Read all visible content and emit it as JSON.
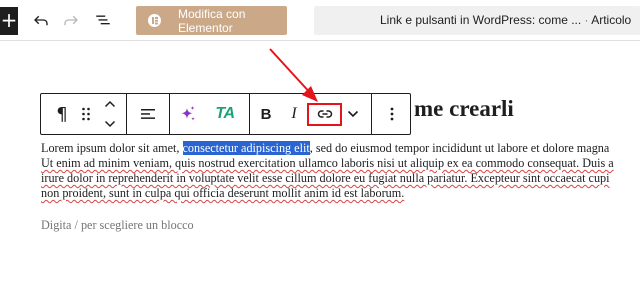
{
  "topbar": {
    "inserter_symbol": "+",
    "elementor_label": "Modifica con Elementor",
    "doc_title": "Link e pulsanti in WordPress: come ...",
    "doc_separator": "·",
    "doc_type": "Articolo",
    "icons": [
      "plus-icon",
      "undo-icon",
      "redo-icon",
      "list-view-icon",
      "elementor-logo-icon"
    ]
  },
  "block_toolbar": {
    "paragraph_symbol": "¶",
    "ta_label": "TA",
    "bold_label": "B",
    "italic_label": "I",
    "icons": [
      "paragraph-icon",
      "drag-handle-icon",
      "move-up-icon",
      "move-down-icon",
      "align-icon",
      "ai-sparkle-icon",
      "bold-icon",
      "italic-icon",
      "link-icon",
      "chevron-down-icon",
      "more-options-icon"
    ]
  },
  "content": {
    "heading_visible": "me crearli",
    "paragraph": {
      "l1_pre": "Lorem ipsum dolor sit amet, ",
      "l1_selected": "consectetur adipiscing elit",
      "l1_post": ", sed do eiusmod tempor incididunt ut labore et dolore magna",
      "l2": "Ut enim ad minim veniam, quis nostrud exercitation ullamco laboris nisi ut aliquip ex ea commodo consequat. Duis a",
      "l3": "irure dolor in reprehenderit in voluptate velit esse cillum dolore eu fugiat nulla pariatur. Excepteur sint occaecat cupi",
      "l4": "non proident, sunt in culpa qui officia deserunt mollit anim id est laborum."
    },
    "placeholder": "Digita / per scegliere un blocco"
  },
  "colors": {
    "elementor": "#cba988",
    "selection": "#2a64d0",
    "annotation": "#e5141a",
    "ta": "#1aa37a",
    "sparkle": "#8a34c8"
  }
}
